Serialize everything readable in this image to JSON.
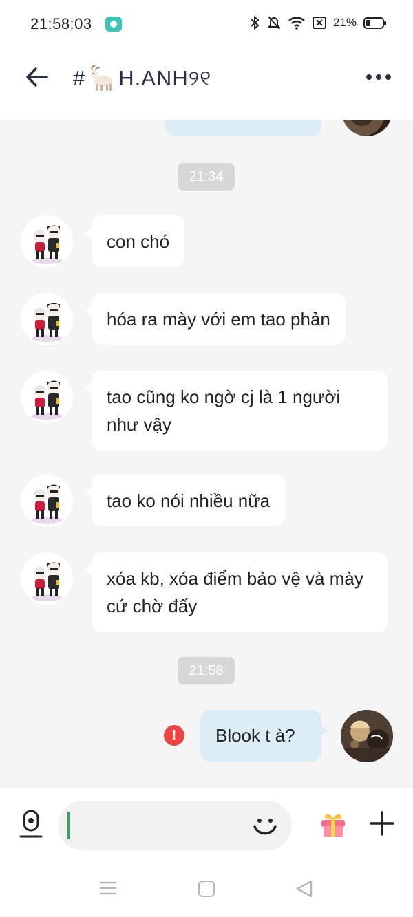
{
  "status_bar": {
    "time": "21:58:03",
    "battery": "21%",
    "icons": [
      "app-notification-icon",
      "bluetooth-icon",
      "mute-icon",
      "wifi-icon",
      "sim-icon",
      "battery-icon"
    ]
  },
  "header": {
    "title_prefix": "#",
    "title_emoji": "goat-icon",
    "title_text": "H.ANH୨୧"
  },
  "messages": [
    {
      "type": "timestamp",
      "text": "21:34"
    },
    {
      "type": "received",
      "text": "con chó"
    },
    {
      "type": "received",
      "text": "hóa ra mày với em tao phản"
    },
    {
      "type": "received",
      "text": "tao cũng ko ngờ cj là 1 người như vậy"
    },
    {
      "type": "received",
      "text": "tao ko nói nhiều nữa"
    },
    {
      "type": "received",
      "text": "xóa kb, xóa điểm bảo vệ và mày cứ chờ đấy"
    },
    {
      "type": "timestamp",
      "text": "21:58"
    },
    {
      "type": "sent",
      "text": "Blook t à?",
      "status": "failed"
    }
  ],
  "input_bar": {
    "placeholder": "",
    "value": ""
  },
  "colors": {
    "sent_bubble": "#dcedf6",
    "received_bubble": "#ffffff",
    "error": "#ee4444",
    "caret": "#19b25c",
    "chat_background": "#f5f5f5"
  }
}
